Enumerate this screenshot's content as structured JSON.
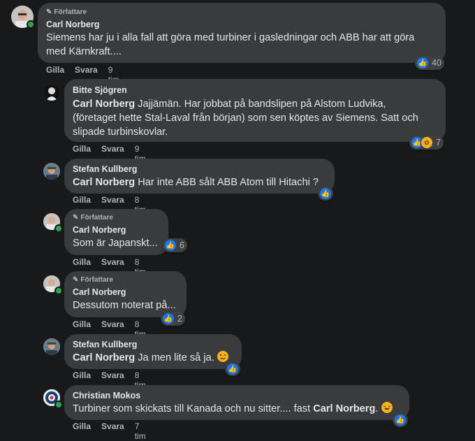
{
  "comments": [
    {
      "author": "Carl Norberg",
      "badge": "Författare",
      "text_lines": [
        "Siemens har ju i alla fall att göra med turbiner i gasledningar och ABB har att göra",
        "med Kärnkraft...."
      ],
      "like_label": "Gilla",
      "reply_label": "Svara",
      "time": "9 tim",
      "reaction_count": "40"
    },
    {
      "author": "Bitte Sjögren",
      "mention": "Carl Norberg",
      "text_lines": [
        " Jajjämän. Har jobbat på bandslipen på Alstom Ludvika,",
        "(företaget hette Stal-Laval från början) som sen köptes av Siemens. Satt och",
        "slipade turbinskovlar."
      ],
      "like_label": "Gilla",
      "reply_label": "Svara",
      "time": "9 tim",
      "reaction_count": "7"
    },
    {
      "author": "Stefan Kullberg",
      "mention": "Carl Norberg",
      "text": " Har inte ABB sålt ABB Atom till Hitachi ?",
      "like_label": "Gilla",
      "reply_label": "Svara",
      "time": "8 tim"
    },
    {
      "author": "Carl Norberg",
      "badge": "Författare",
      "text": "Som är Japanskt...",
      "like_label": "Gilla",
      "reply_label": "Svara",
      "time": "8 tim",
      "reaction_count": "6"
    },
    {
      "author": "Carl Norberg",
      "badge": "Författare",
      "text": "Dessutom noterat på...",
      "like_label": "Gilla",
      "reply_label": "Svara",
      "time": "8 tim",
      "reaction_count": "2"
    },
    {
      "author": "Stefan Kullberg",
      "mention": "Carl Norberg",
      "text": " Ja men lite så ja.",
      "like_label": "Gilla",
      "reply_label": "Svara",
      "time": "8 tim"
    },
    {
      "author": "Christian Mokos",
      "text": "Turbiner som skickats till Kanada och nu sitter.... fast ",
      "mention": "Carl Norberg",
      "text_after": ".",
      "like_label": "Gilla",
      "reply_label": "Svara",
      "time": "7 tim"
    }
  ],
  "colors": {
    "like": "#1877f2",
    "online": "#31a24c",
    "bubble": "#3a3b3c",
    "background": "#18191a"
  },
  "icons": {
    "badge": "pencil-icon",
    "like": "thumbs-up-icon",
    "wow": "wow-face-icon"
  }
}
